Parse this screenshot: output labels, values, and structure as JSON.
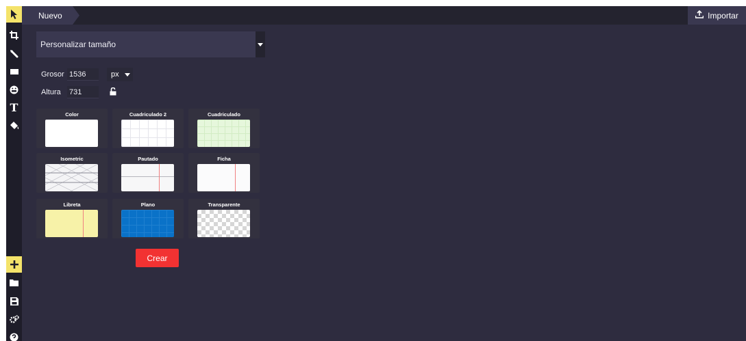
{
  "header": {
    "tab_label": "Nuevo",
    "import_label": "Importar",
    "import_icon": "upload-icon"
  },
  "toolbar": {
    "tools": [
      {
        "name": "select-icon",
        "active": true
      },
      {
        "name": "crop-icon"
      },
      {
        "name": "pencil-icon"
      },
      {
        "name": "rectangle-icon"
      },
      {
        "name": "emoji-icon"
      },
      {
        "name": "text-icon"
      },
      {
        "name": "paint-bucket-icon"
      }
    ],
    "bottom_tools": [
      {
        "name": "plus-icon",
        "active": true
      },
      {
        "name": "folder-icon"
      },
      {
        "name": "save-icon"
      },
      {
        "name": "settings-icon"
      },
      {
        "name": "help-icon"
      }
    ],
    "text_tool_glyph": "T"
  },
  "panel": {
    "size_preset": "Personalizar tamaño",
    "width_label": "Grosor",
    "width_value": "1536",
    "height_label": "Altura",
    "height_value": "731",
    "unit": "px",
    "backgrounds": [
      {
        "label": "Color"
      },
      {
        "label": "Cuadriculado 2"
      },
      {
        "label": "Cuadriculado"
      },
      {
        "label": "Isometric"
      },
      {
        "label": "Pautado"
      },
      {
        "label": "Ficha"
      },
      {
        "label": "Libreta"
      },
      {
        "label": "Plano"
      },
      {
        "label": "Transparente"
      }
    ],
    "create_label": "Crear"
  },
  "colors": {
    "app_bg": "#2e2c3f",
    "toolbar_bg": "#1e1d29",
    "accent_yellow": "#f4e36a",
    "create_red": "#f23232",
    "plano_blue": "#0a72c8",
    "libreta_yellow": "#f7f2a8",
    "cuadriculado_green": "#e6f7dc"
  }
}
